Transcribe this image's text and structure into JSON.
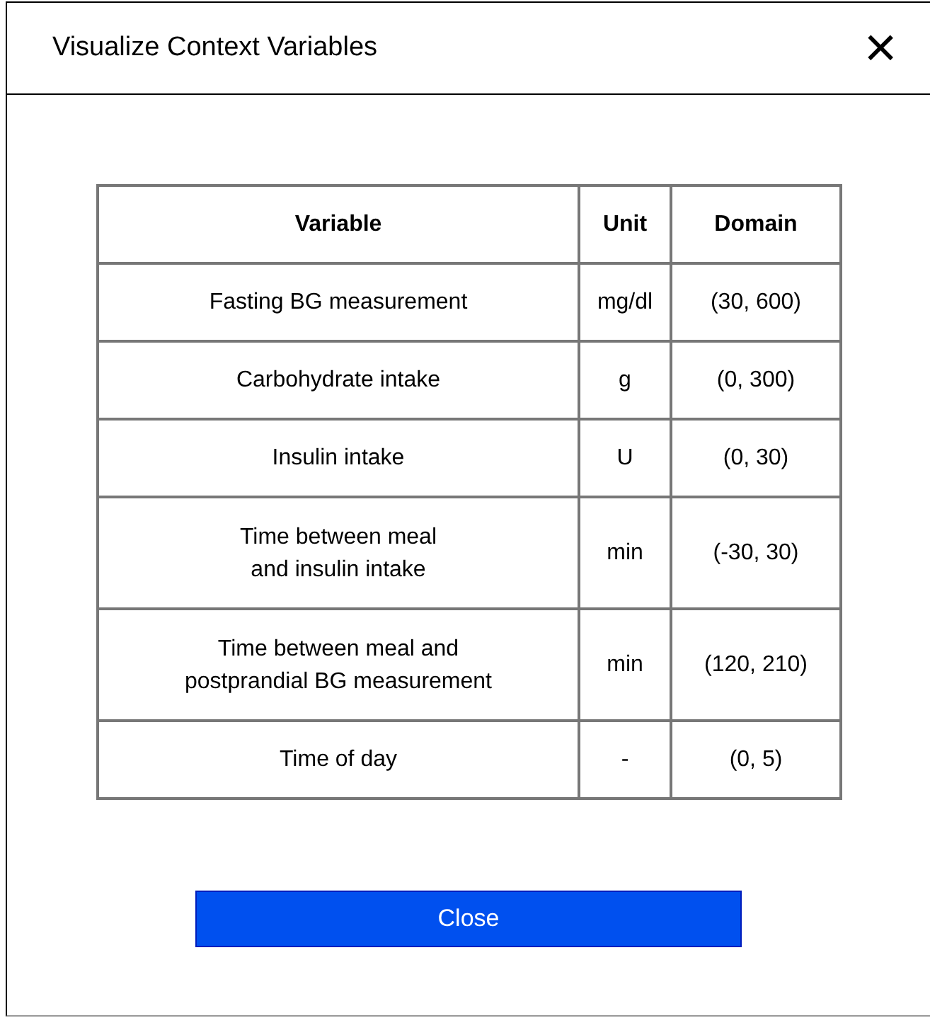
{
  "dialog": {
    "title": "Visualize Context Variables",
    "close_icon": "×"
  },
  "table": {
    "columns": [
      "Variable",
      "Unit",
      "Domain"
    ],
    "rows": [
      [
        "Fasting BG measurement",
        "mg/dl",
        "(30, 600)"
      ],
      [
        "Carbohydrate intake",
        "g",
        "(0, 300)"
      ],
      [
        "Insulin intake",
        "U",
        "(0, 30)"
      ],
      [
        "Time between meal\nand insulin intake",
        "min",
        "(-30, 30)"
      ],
      [
        "Time between meal and\npostprandial BG measurement",
        "min",
        "(120, 210)"
      ],
      [
        "Time of day",
        "-",
        "(0, 5)"
      ]
    ]
  },
  "button": {
    "label": "Close"
  }
}
